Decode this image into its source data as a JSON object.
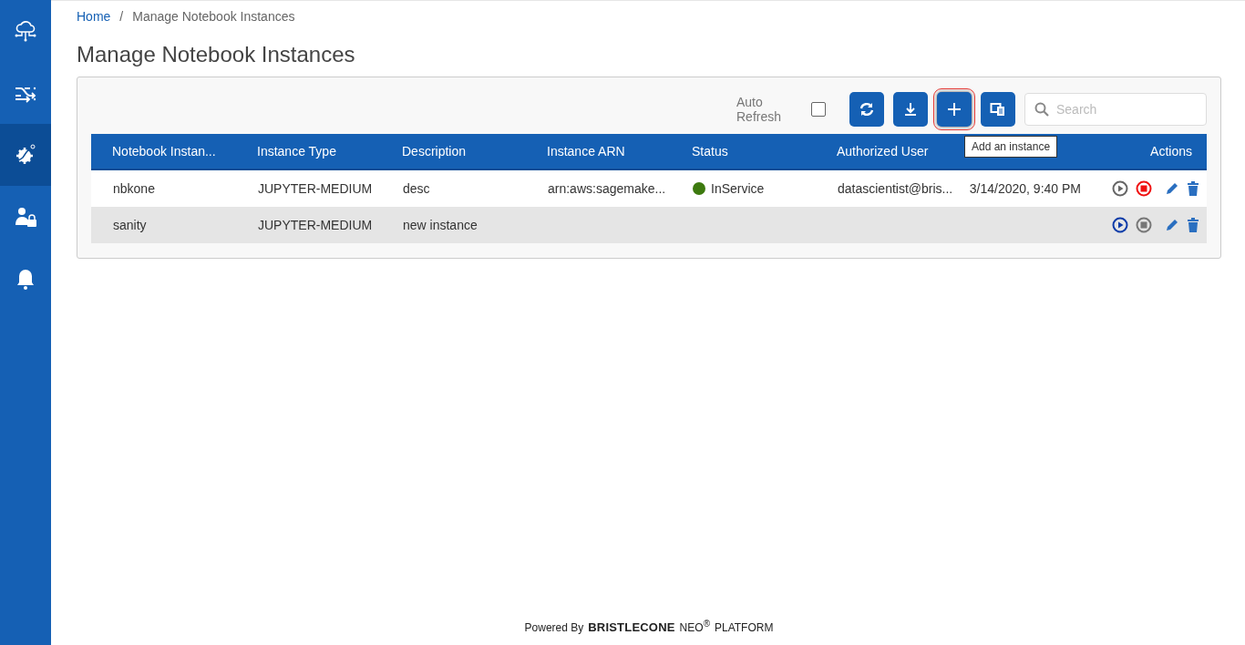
{
  "sidebar": {
    "items": [
      {
        "kind": "cloud",
        "selected": false
      },
      {
        "kind": "flow",
        "selected": false
      },
      {
        "kind": "gear",
        "selected": true
      },
      {
        "kind": "user",
        "selected": false
      },
      {
        "kind": "bell",
        "selected": false
      }
    ]
  },
  "breadcrumb": {
    "separator": "/",
    "items": [
      {
        "label": "Home",
        "link": true
      },
      {
        "label": "Manage Notebook Instances",
        "link": false
      }
    ]
  },
  "title": "Manage Notebook Instances",
  "toolbar": {
    "auto_refresh": {
      "label": "Auto Refresh",
      "checked": false
    },
    "buttons": [
      {
        "kind": "refresh",
        "highlighted": false
      },
      {
        "kind": "download",
        "highlighted": false
      },
      {
        "kind": "add",
        "highlighted": true
      },
      {
        "kind": "copy",
        "highlighted": false
      }
    ],
    "tooltip": "Add an instance",
    "search": {
      "placeholder": "Search"
    }
  },
  "table": {
    "columns": [
      {
        "label": "Notebook Instan..."
      },
      {
        "label": "Instance Type"
      },
      {
        "label": "Description"
      },
      {
        "label": "Instance ARN"
      },
      {
        "label": "Status"
      },
      {
        "label": "Authorized User"
      },
      {},
      {
        "label": "Actions"
      }
    ],
    "rows": [
      {
        "name": "nbkone",
        "type": "JUPYTER-MEDIUM",
        "description": "desc",
        "arn": "arn:aws:sagemake...",
        "status": {
          "label": "InService",
          "color": "#3d7a0f"
        },
        "user": "datascientist@bris...",
        "time": "3/14/2020, 9:40 PM",
        "start_enabled": false,
        "stop_enabled": true,
        "highlighted": false
      },
      {
        "name": "sanity",
        "type": "JUPYTER-MEDIUM",
        "description": "new instance",
        "start_enabled": true,
        "stop_enabled": false,
        "highlighted": true
      }
    ]
  },
  "footer": {
    "prefix": "Powered By",
    "brand": "BRISTLECONE",
    "product": "NEO$^{®}$",
    "suffix": "PLATFORM"
  }
}
